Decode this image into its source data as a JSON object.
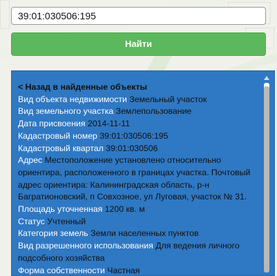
{
  "search": {
    "value": "39:01:030506:195",
    "placeholder": ""
  },
  "find_button": {
    "label": "Найти"
  },
  "panel": {
    "back_link": "< Назад в найденные объекты",
    "rows": [
      {
        "label": "Вид объекта недвижимости",
        "value": "Земельный участок"
      },
      {
        "label": "Вид земельного участка",
        "value": "Землепользование"
      },
      {
        "label": "Дата присвоения",
        "value": "2014-11-11"
      },
      {
        "label": "Кадастровый номер",
        "value": "39:01:030506:195"
      },
      {
        "label": "Кадастровый квартал",
        "value": "39:01:030506"
      },
      {
        "label": "Адрес",
        "value": "Местоположение установлено относительно ориентира, расположенного в границах участка. Почтовый адрес ориентира: Калининградская область, р-н Багратионовский, п Совхозное, ул Луговая, участок № 31."
      },
      {
        "label": "Площадь уточненная",
        "value": "1200 кв. м"
      },
      {
        "label": "Статус",
        "value": "Учтенный"
      },
      {
        "label": "Категория земель",
        "value": "Земли населенных пунктов"
      },
      {
        "label": "Вид разрешенного использования",
        "value": "Для ведения личного подсобного хозяйства"
      },
      {
        "label": "Форма собственности",
        "value": "Частная"
      }
    ]
  },
  "colors": {
    "panel_bg": "#2f78c3",
    "button_bg": "#5cb85c",
    "label_text": "#ffffff",
    "value_text": "#111111"
  }
}
